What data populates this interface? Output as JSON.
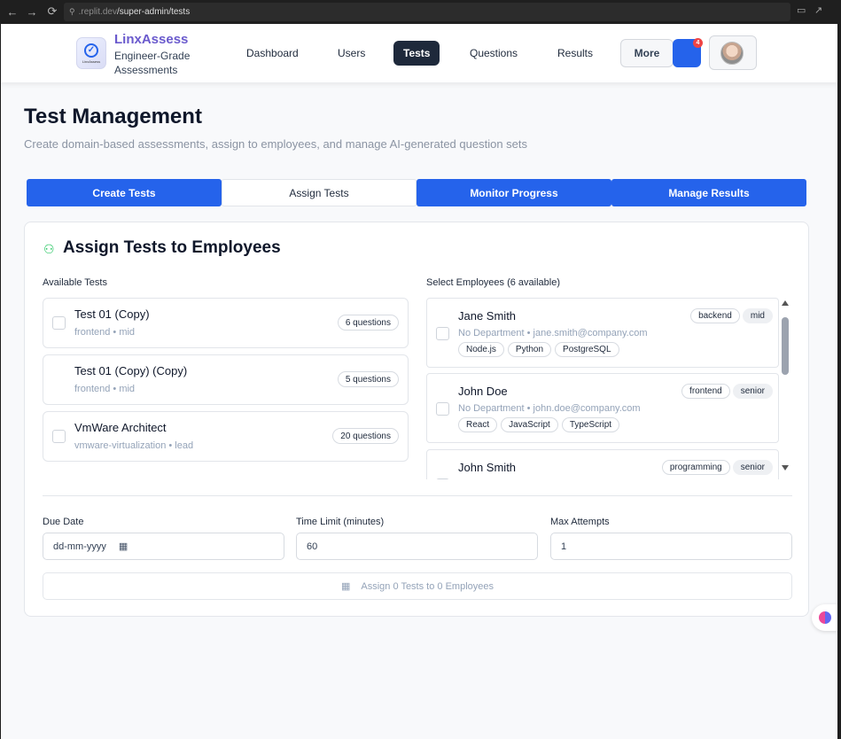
{
  "browser": {
    "url_prefix": ".replit.dev",
    "url_path": "/super-admin/tests"
  },
  "header": {
    "brand": "LinxAssess",
    "tagline": "Engineer-Grade Assessments",
    "logo_text": "LinxAssess",
    "nav": [
      "Dashboard",
      "Users",
      "Tests",
      "Questions",
      "Results"
    ],
    "active_nav": "Tests",
    "more_label": "More",
    "notification_count": "4"
  },
  "page": {
    "title": "Test Management",
    "subtitle": "Create domain-based assessments, assign to employees, and manage AI-generated question sets"
  },
  "tabs": [
    "Create Tests",
    "Assign Tests",
    "Monitor Progress",
    "Manage Results"
  ],
  "card": {
    "title": "Assign Tests to Employees",
    "available_label": "Available Tests",
    "employees_label": "Select Employees (6 available)"
  },
  "tests": [
    {
      "name": "Test 01 (Copy)",
      "meta": "frontend • mid",
      "questions": "6 questions"
    },
    {
      "name": "Test 01 (Copy) (Copy)",
      "meta": "frontend • mid",
      "questions": "5 questions"
    },
    {
      "name": "VmWare Architect",
      "meta": "vmware-virtualization • lead",
      "questions": "20 questions"
    }
  ],
  "employees": [
    {
      "name": "Jane Smith",
      "meta": "No Department • jane.smith@company.com",
      "role": "backend",
      "level": "mid",
      "skills": [
        "Node.js",
        "Python",
        "PostgreSQL"
      ]
    },
    {
      "name": "John Doe",
      "meta": "No Department • john.doe@company.com",
      "role": "frontend",
      "level": "senior",
      "skills": [
        "React",
        "JavaScript",
        "TypeScript"
      ]
    },
    {
      "name": "John Smith",
      "meta": "",
      "role": "programming",
      "level": "senior",
      "skills": []
    }
  ],
  "form": {
    "due_date_label": "Due Date",
    "due_date_placeholder": "dd-mm-yyyy",
    "time_limit_label": "Time Limit (minutes)",
    "time_limit_value": "60",
    "max_attempts_label": "Max Attempts",
    "max_attempts_value": "1",
    "assign_button": "Assign 0 Tests to 0 Employees"
  },
  "colors": {
    "primary": "#2563eb",
    "nav_active": "#1e293b",
    "brand": "#6a5acd",
    "badge": "#ef4444",
    "card_icon": "#22c55e"
  }
}
